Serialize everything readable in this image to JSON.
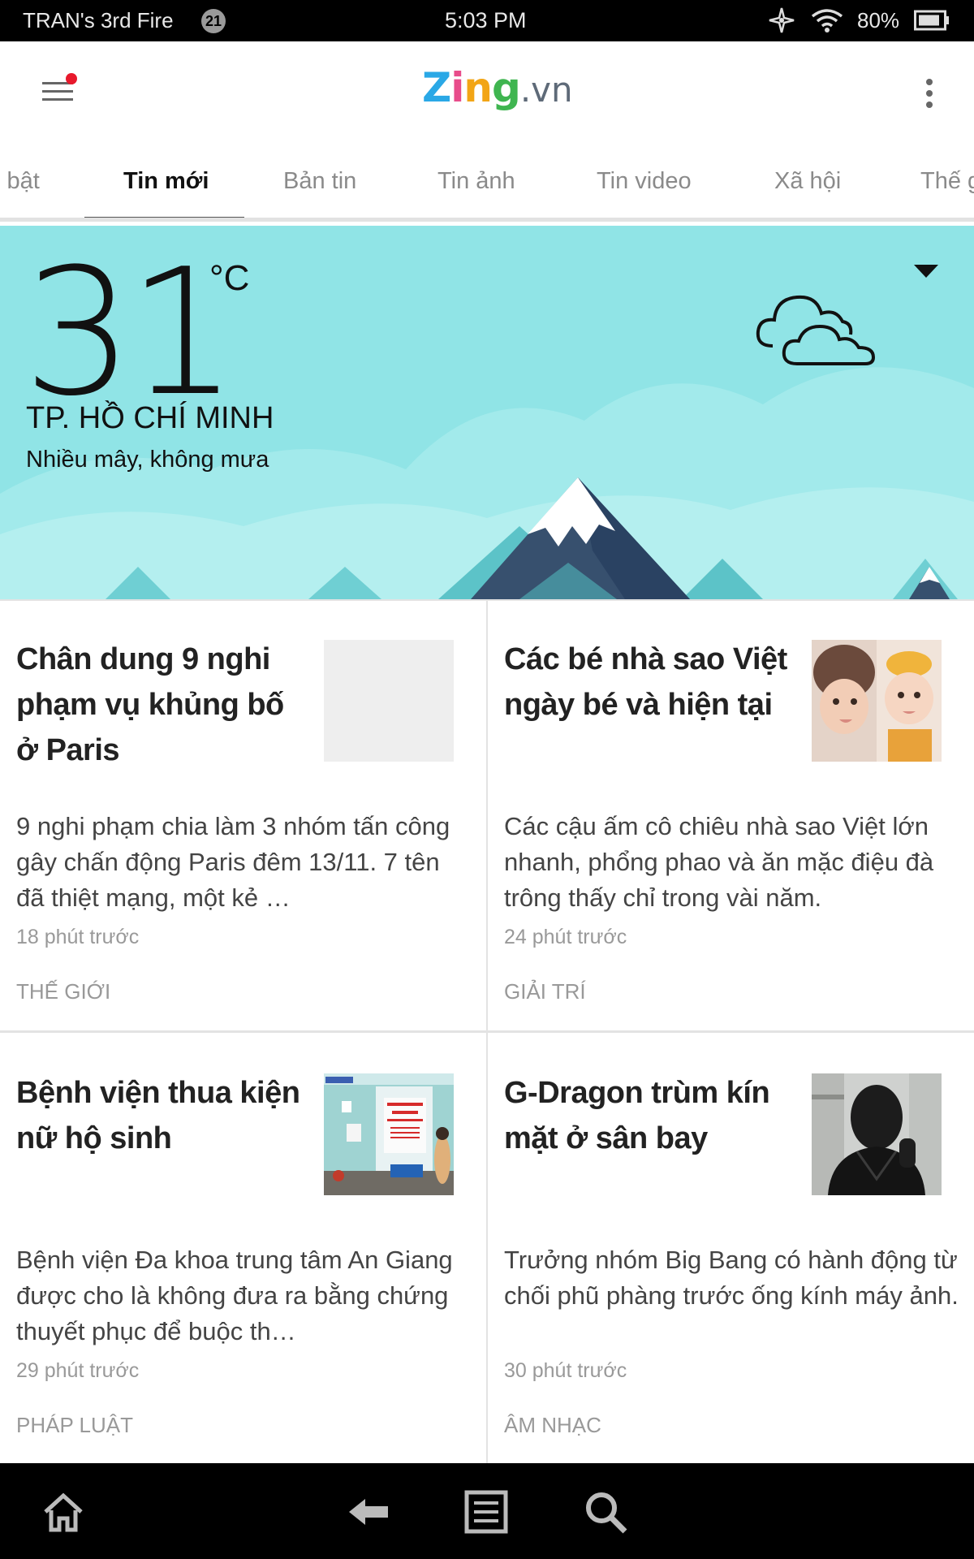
{
  "status_bar": {
    "device_name": "TRAN's 3rd Fire",
    "notification_count": "21",
    "time": "5:03 PM",
    "battery": "80%"
  },
  "header": {
    "logo_parts": [
      "Z",
      "i",
      "n",
      "g",
      ".vn"
    ]
  },
  "tabs": [
    {
      "label": "i bật",
      "active": false
    },
    {
      "label": "Tin mới",
      "active": true
    },
    {
      "label": "Bản tin",
      "active": false
    },
    {
      "label": "Tin ảnh",
      "active": false
    },
    {
      "label": "Tin video",
      "active": false
    },
    {
      "label": "Xã hội",
      "active": false
    },
    {
      "label": "Thế g",
      "active": false
    }
  ],
  "weather": {
    "temperature": "31",
    "unit": "°C",
    "city": "TP. HỒ CHÍ MINH",
    "condition": "Nhiều mây, không mưa"
  },
  "articles": [
    {
      "title": "Chân dung 9 nghi phạm vụ khủng bố ở Paris",
      "description": "9 nghi phạm chia làm 3 nhóm tấn công gây chấn động Paris đêm 13/11. 7 tên đã thiệt mạng, một kẻ …",
      "time": "18 phút trước",
      "category": "THẾ GIỚI"
    },
    {
      "title": "Các bé nhà sao Việt ngày bé và hiện tại",
      "description": "Các cậu ấm cô chiêu nhà sao Việt lớn nhanh, phổng phao và ăn mặc điệu đà trông thấy chỉ trong vài năm.",
      "time": "24 phút trước",
      "category": "GIẢI TRÍ"
    },
    {
      "title": "Bệnh viện thua kiện nữ hộ sinh",
      "description": "Bệnh viện Đa khoa trung tâm An Giang được cho là không đưa ra bằng chứng thuyết phục để buộc th…",
      "time": "29 phút trước",
      "category": "PHÁP LUẬT"
    },
    {
      "title": "G-Dragon trùm kín mặt ở sân bay",
      "description": "Trưởng nhóm Big Bang có hành động từ chối phũ phàng trước ống kính máy ảnh.",
      "time": "30 phút trước",
      "category": "ÂM NHẠC"
    }
  ],
  "icons": {
    "menu": "hamburger-menu-icon",
    "more": "vertical-dots-icon",
    "weather": "cloud-icon",
    "nav": [
      "home-icon",
      "back-arrow-icon",
      "recent-apps-icon",
      "search-icon"
    ]
  },
  "colors": {
    "weather_bg": "#90e4e6",
    "notification_dot": "#e8192c",
    "logo_z": "#2aa8e6",
    "logo_i": "#e84c8b",
    "logo_n": "#f2a516",
    "logo_g": "#3fb550"
  }
}
